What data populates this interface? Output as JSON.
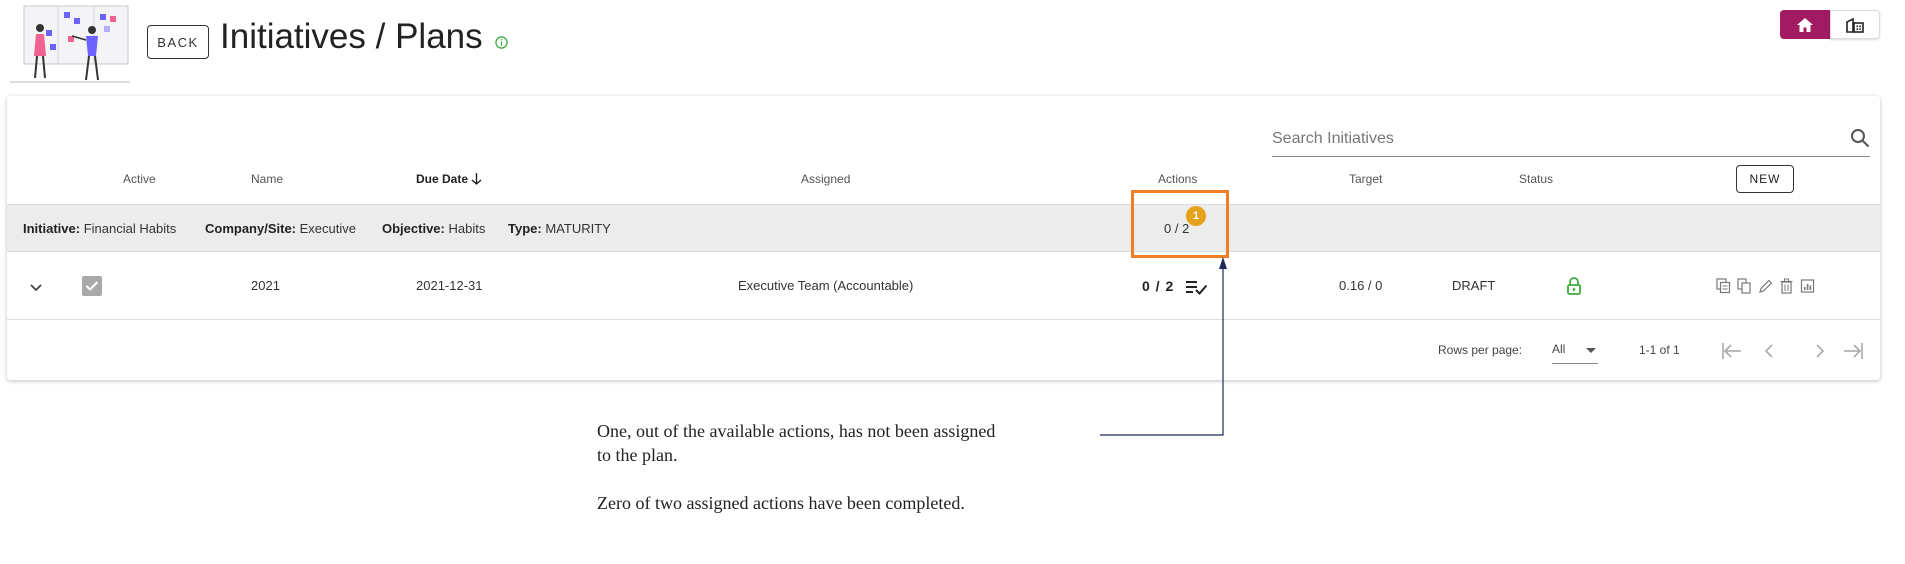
{
  "header": {
    "back_label": "BACK",
    "title": "Initiatives / Plans"
  },
  "search": {
    "placeholder": "Search Initiatives"
  },
  "table": {
    "columns": {
      "active": "Active",
      "name": "Name",
      "due_date": "Due Date",
      "assigned": "Assigned",
      "actions": "Actions",
      "target": "Target",
      "status": "Status"
    },
    "new_label": "NEW",
    "group": {
      "initiative_label": "Initiative:",
      "initiative": "Financial Habits",
      "company_label": "Company/Site:",
      "company": "Executive",
      "objective_label": "Objective:",
      "objective": "Habits",
      "type_label": "Type:",
      "type": "MATURITY",
      "actions": "0 / 2",
      "unassigned_badge": "1"
    },
    "rows": [
      {
        "active": true,
        "name": "2021",
        "due_date": "2021-12-31",
        "assigned": "Executive Team (Accountable)",
        "actions": "0 / 2",
        "target": "0.16 / 0",
        "status": "DRAFT"
      }
    ],
    "footer": {
      "rows_per_page_label": "Rows per page:",
      "rows_per_page_value": "All",
      "range": "1-1 of 1"
    }
  },
  "annotation": {
    "line1": "One, out of the available actions, has not been assigned",
    "line2": "to the plan.",
    "line3": "Zero of two assigned actions have been completed."
  },
  "colors": {
    "brand": "#a21a62",
    "highlight": "#ee7f26",
    "badge": "#e5a21a",
    "lock": "#3dab3d",
    "info": "#3dab3d"
  }
}
